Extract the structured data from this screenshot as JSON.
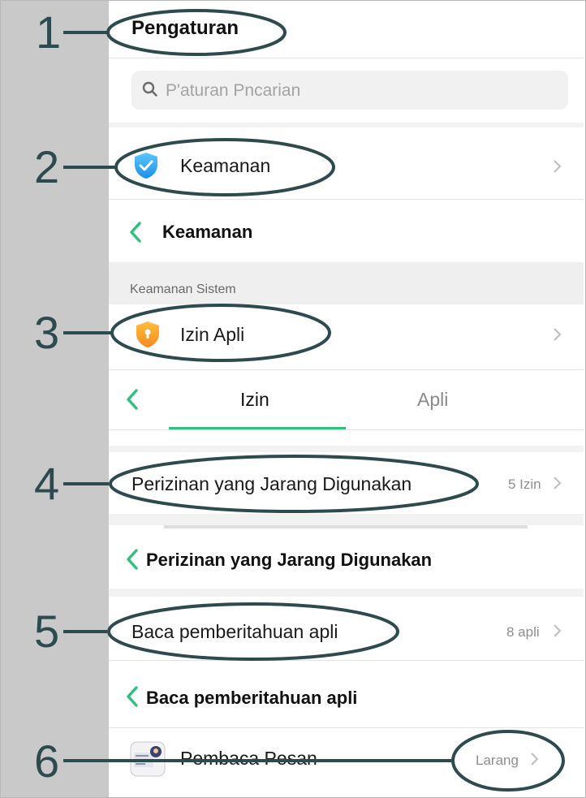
{
  "settings": {
    "title": "Pengaturan",
    "search_placeholder": "P'aturan Pncarian"
  },
  "rows": {
    "keamanan_label": "Keamanan",
    "izin_apli_label": "Izin Apli",
    "rare_perm_label": "Perizinan yang Jarang Digunakan",
    "rare_perm_count": "5 Izin",
    "read_notif_label": "Baca pemberitahuan apli",
    "read_notif_count": "8 apli",
    "reader_app_label": "Pembaca Pesan",
    "reader_app_status": "Larang"
  },
  "headers": {
    "keamanan": "Keamanan",
    "rare_perm": "Perizinan yang Jarang Digunakan",
    "read_notif": "Baca pemberitahuan apli"
  },
  "section_caption": "Keamanan Sistem",
  "tabs": [
    {
      "label": "Izin",
      "active": true
    },
    {
      "label": "Apli",
      "active": false
    }
  ],
  "annotations": [
    "1",
    "2",
    "3",
    "4",
    "5",
    "6"
  ],
  "colors": {
    "accent_green": "#2fc07d",
    "annotation_ink": "#2d4a4f",
    "gutter": "#c9c9c9"
  },
  "icons": [
    "search-icon",
    "shield-check-icon",
    "shield-lock-icon",
    "chevron-right-icon",
    "back-arrow-icon",
    "app-icon-pembaca-pesan"
  ]
}
